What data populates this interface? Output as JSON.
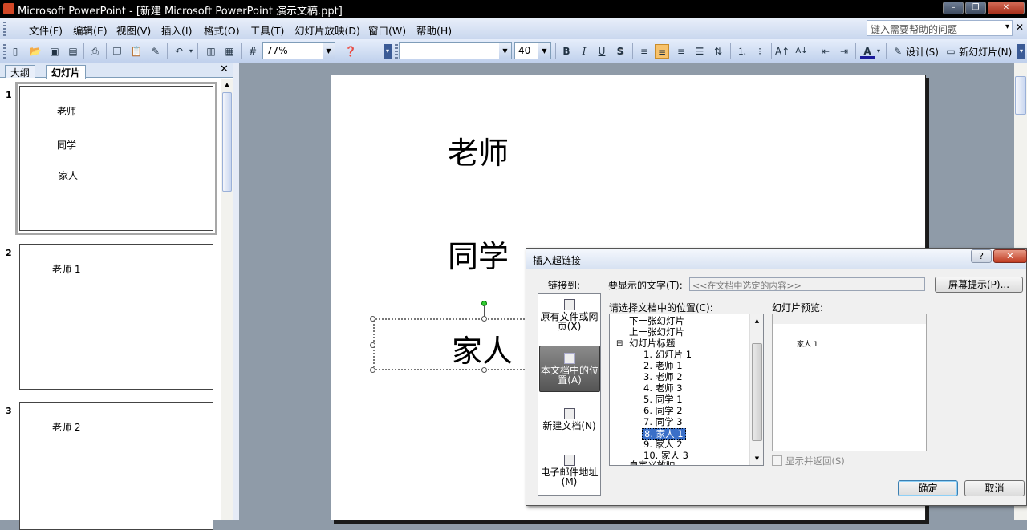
{
  "window": {
    "title": "Microsoft PowerPoint - [新建 Microsoft PowerPoint 演示文稿.ppt]",
    "min": "–",
    "restore": "❐",
    "close": "✕"
  },
  "menus": [
    "文件(F)",
    "编辑(E)",
    "视图(V)",
    "插入(I)",
    "格式(O)",
    "工具(T)",
    "幻灯片放映(D)",
    "窗口(W)",
    "帮助(H)"
  ],
  "help_search": {
    "placeholder": "键入需要帮助的问题",
    "arrow": "▾",
    "close": "✕"
  },
  "toolbar": {
    "zoom": "77%",
    "font_name": "",
    "font_size": "40",
    "bold": "B",
    "italic": "I",
    "underline": "U",
    "shadow": "S",
    "design": "设计(S)",
    "new_slide": "新幻灯片(N)"
  },
  "outline_tabs": {
    "outline": "大纲",
    "slides": "幻灯片",
    "close": "✕"
  },
  "thumbnails": [
    {
      "num": "1",
      "lines": [
        "老师",
        "同学",
        "家人"
      ]
    },
    {
      "num": "2",
      "lines": [
        "老师 1"
      ]
    },
    {
      "num": "3",
      "lines": [
        "老师 2"
      ]
    }
  ],
  "slide": {
    "lines": [
      "老师",
      "同学",
      "家人"
    ]
  },
  "dialog": {
    "title": "插入超链接",
    "help": "?",
    "close": "✕",
    "link_to_label": "链接到:",
    "display_text_label": "要显示的文字(T):",
    "display_text_value": "<<在文档中选定的内容>>",
    "screen_tip_button": "屏幕提示(P)...",
    "location_label": "请选择文档中的位置(C):",
    "preview_label": "幻灯片预览:",
    "link_targets": [
      "原有文件或网页(X)",
      "本文档中的位置(A)",
      "新建文档(N)",
      "电子邮件地址(M)"
    ],
    "tree": {
      "next_slide": "下一张幻灯片",
      "prev_slide": "上一张幻灯片",
      "titles_group": "幻灯片标题",
      "collapse": "⊟",
      "items": [
        "1. 幻灯片 1",
        "2. 老师 1",
        "3. 老师 2",
        "4. 老师 3",
        "5. 同学 1",
        "6. 同学 2",
        "7. 同学 3",
        "8. 家人 1",
        "9. 家人 2",
        "10. 家人 3"
      ],
      "selected_index": 7,
      "custom_shows": "自定义放映"
    },
    "preview_text": "家人 1",
    "show_and_return": "显示并返回(S)",
    "ok": "确定",
    "cancel": "取消"
  }
}
